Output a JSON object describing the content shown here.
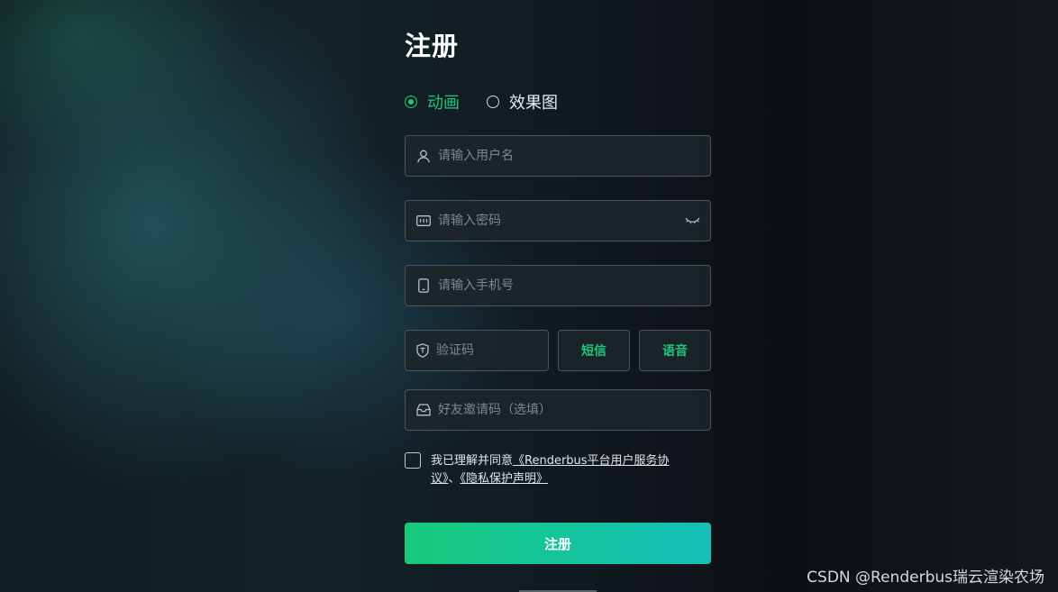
{
  "form": {
    "title": "注册",
    "type_options": [
      {
        "label": "动画",
        "selected": true
      },
      {
        "label": "效果图",
        "selected": false
      }
    ],
    "username": {
      "placeholder": "请输入用户名",
      "value": ""
    },
    "password": {
      "placeholder": "请输入密码",
      "value": ""
    },
    "phone": {
      "placeholder": "请输入手机号",
      "value": ""
    },
    "code": {
      "placeholder": "验证码",
      "value": ""
    },
    "sms_button": "短信",
    "voice_button": "语音",
    "invite": {
      "placeholder": "好友邀请码（选填）",
      "value": ""
    },
    "agreement": {
      "prefix": "我已理解并同意",
      "terms_link": "《Renderbus平台用户服务协议》",
      "separator": "、",
      "privacy_link": "《隐私保护声明》",
      "checked": false
    },
    "submit_label": "注册"
  },
  "watermark": "CSDN @Renderbus瑞云渲染农场",
  "colors": {
    "accent": "#1ec77d",
    "gradient_end": "#14c0ba"
  }
}
